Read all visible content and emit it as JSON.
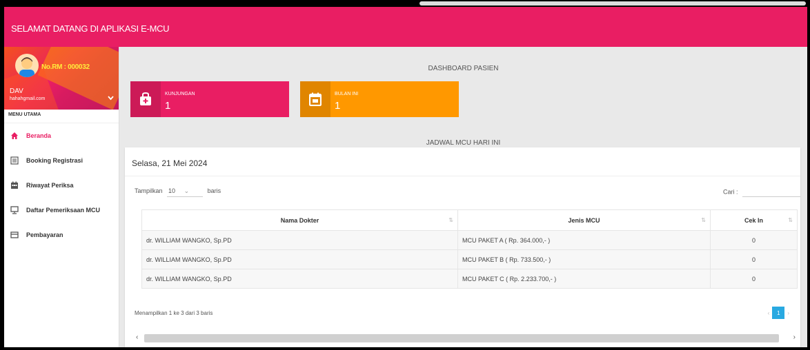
{
  "header": {
    "title": "SELAMAT DATANG DI APLIKASI E-MCU"
  },
  "profile": {
    "rm": "No.RM : 000032",
    "name": "DAV",
    "email": "hahahgmail.com"
  },
  "menu": {
    "header": "MENU UTAMA",
    "items": [
      {
        "label": "Beranda",
        "icon": "home-icon",
        "active": true
      },
      {
        "label": "Booking Registrasi",
        "icon": "list-icon",
        "active": false
      },
      {
        "label": "Riwayat Periksa",
        "icon": "calendar-grid-icon",
        "active": false
      },
      {
        "label": "Daftar Pemeriksaan MCU",
        "icon": "monitor-icon",
        "active": false
      },
      {
        "label": "Pembayaran",
        "icon": "card-icon",
        "active": false
      }
    ]
  },
  "dashboard": {
    "title": "DASHBOARD PASIEN",
    "cards": [
      {
        "label": "KUNJUNGAN",
        "value": "1",
        "icon": "medical-bag-icon",
        "color": "#e91e63"
      },
      {
        "label": "BULAN INI",
        "value": "1",
        "icon": "calendar-icon",
        "color": "#ff9800"
      }
    ],
    "schedule_title": "JADWAL MCU HARI INI"
  },
  "panel": {
    "date": "Selasa, 21 Mei 2024",
    "show_label": "Tampilkan",
    "show_value": "10",
    "rows_label": "baris",
    "search_label": "Cari :",
    "columns": [
      "Nama Dokter",
      "Jenis MCU",
      "Cek In"
    ],
    "rows": [
      [
        "dr. WILLIAM WANGKO, Sp.PD",
        "MCU PAKET A ( Rp. 364.000,- )",
        "0"
      ],
      [
        "dr. WILLIAM WANGKO, Sp.PD",
        "MCU PAKET B ( Rp. 733.500,- )",
        "0"
      ],
      [
        "dr. WILLIAM WANGKO, Sp.PD",
        "MCU PAKET C ( Rp. 2.233.700,- )",
        "0"
      ]
    ],
    "info": "Menampilkan 1 ke 3 dari 3 baris",
    "page": "1"
  },
  "colors": {
    "primary": "#e91e63",
    "orange": "#ff9800",
    "pager": "#29a9e1"
  }
}
